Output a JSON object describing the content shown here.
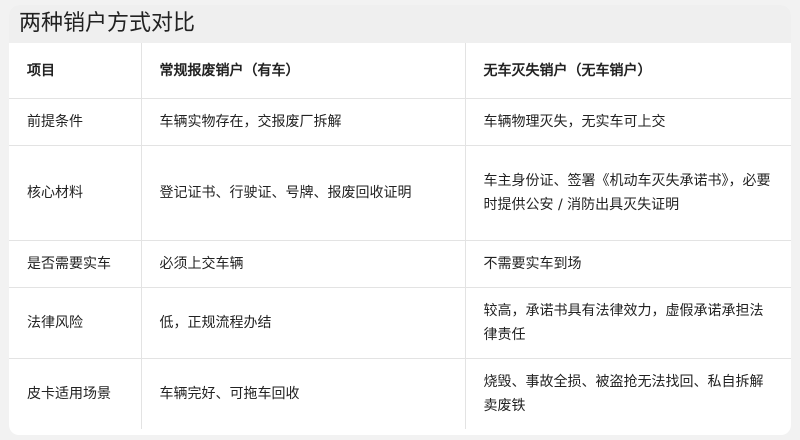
{
  "title": "两种销户方式对比",
  "table": {
    "headers": [
      "项目",
      "常规报废销户（有车）",
      "无车灭失销户（无车销户）"
    ],
    "rows": [
      [
        "前提条件",
        "车辆实物存在，交报废厂拆解",
        "车辆物理灭失，无实车可上交"
      ],
      [
        "核心材料",
        "登记证书、行驶证、号牌、报废回收证明",
        "车主身份证、签署《机动车灭失承诺书》，必要时提供公安 / 消防出具灭失证明"
      ],
      [
        "是否需要实车",
        "必须上交车辆",
        "不需要实车到场"
      ],
      [
        "法律风险",
        "低，正规流程办结",
        "较高，承诺书具有法律效力，虚假承诺承担法律责任"
      ],
      [
        "皮卡适用场景",
        "车辆完好、可拖车回收",
        "烧毁、事故全损、被盗抢无法找回、私自拆解卖废铁"
      ]
    ]
  }
}
